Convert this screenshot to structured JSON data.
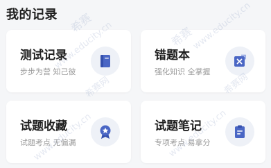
{
  "section_title": "我的记录",
  "cards": [
    {
      "title": "测试记录",
      "subtitle": "步步为营 知己彼",
      "icon": "document-icon"
    },
    {
      "title": "错题本",
      "subtitle": "强化知识 全掌握",
      "icon": "error-book-icon"
    },
    {
      "title": "试题收藏",
      "subtitle": "试题考点 无偏漏",
      "icon": "favorite-badge-icon"
    },
    {
      "title": "试题笔记",
      "subtitle": "专项考点 易拿分",
      "icon": "clipboard-notes-icon"
    }
  ],
  "colors": {
    "accent": "#4a66c4",
    "icon_bg": "#eef1f7",
    "title": "#1f1f1f",
    "subtitle": "#999999",
    "background": "#f5f6f8"
  },
  "watermark": {
    "brand": "希赛",
    "brand_alt": "希赛网",
    "domain": "www.educity.cn"
  }
}
